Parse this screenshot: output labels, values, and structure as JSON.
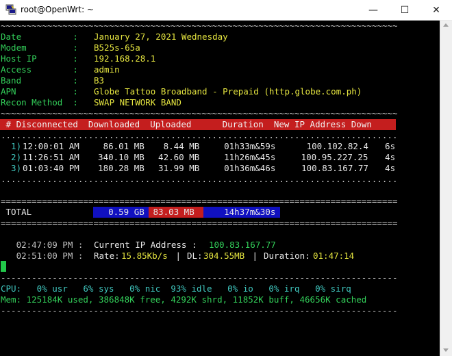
{
  "window": {
    "title": "root@OpenWrt: ~",
    "min_glyph": "—",
    "max_glyph": "☐",
    "close_glyph": "✕"
  },
  "colors": {
    "label": "#33d05a",
    "value": "#e6e640",
    "header_bg": "#c41e1e",
    "total_blue": "#1010c0",
    "cpu": "#40c8c0"
  },
  "rule_tilde": "~~~~~~~~~~~~~~~~~~~~~~~~~~~~~~~~~~~~~~~~~~~~~~~~~~~~~~~~~~~~~~~~~~~~~~~~~~~~~",
  "rule_dots": ".............................................................................",
  "rule_equals": "=============================================================================",
  "rule_dash": "-----------------------------------------------------------------------------",
  "info": [
    {
      "label": "Date          :",
      "value": "January 27, 2021 Wednesday"
    },
    {
      "label": "Modem         :",
      "value": "B525s-65a"
    },
    {
      "label": "Host IP       :",
      "value": "192.168.28.1"
    },
    {
      "label": "Access        :",
      "value": "admin"
    },
    {
      "label": "Band          :",
      "value": "B3"
    },
    {
      "label": "APN           :",
      "value": "Globe Tattoo Broadband - Prepaid (http.globe.com.ph)"
    },
    {
      "label": "Recon Method  :",
      "value": "SWAP NETWORK BAND"
    }
  ],
  "table_header": " # Disconnected  Downloaded  Uploaded      Duration  New IP Address Down",
  "rows": [
    {
      "idx": "  1)",
      "time": "12:00:01 AM",
      "down": "   86.01 MB",
      "up": "   8.44 MB",
      "dur": "    01h33m&59s",
      "ip": "     100.102.82.4",
      "d": "  6s"
    },
    {
      "idx": "  2)",
      "time": "11:26:51 AM",
      "down": "  340.10 MB",
      "up": "  42.60 MB",
      "dur": "    11h26m&45s",
      "ip": "     100.95.227.25",
      "d": "  4s"
    },
    {
      "idx": "  3)",
      "time": "01:03:40 PM",
      "down": "  180.28 MB",
      "up": "  31.99 MB",
      "dur": "    01h36m&46s",
      "ip": "    100.83.167.77",
      "d": "  4s"
    }
  ],
  "total": {
    "label": " TOTAL",
    "downloaded": "    0.59 GB",
    "uploaded": " 83.03 MB",
    "duration": "    14h37m&30s"
  },
  "status": {
    "line1_time": "   02:47:09 PM : ",
    "line1_label": "Current IP Address : ",
    "line1_value": "100.83.167.77",
    "line2_time": "   02:51:00 PM : ",
    "line2_rate_label": "Rate:",
    "line2_rate": "15.85Kb/s",
    "line2_sep1": " | ",
    "line2_dl_label": "DL:",
    "line2_dl": "304.55MB",
    "line2_sep2": " | ",
    "line2_dur_label": "Duration:",
    "line2_dur": "01:47:14"
  },
  "cpu": "CPU:   0% usr   6% sys   0% nic  93% idle   0% io   0% irq   0% sirq",
  "mem": "Mem: 125184K used, 386848K free, 4292K shrd, 11852K buff, 46656K cached"
}
